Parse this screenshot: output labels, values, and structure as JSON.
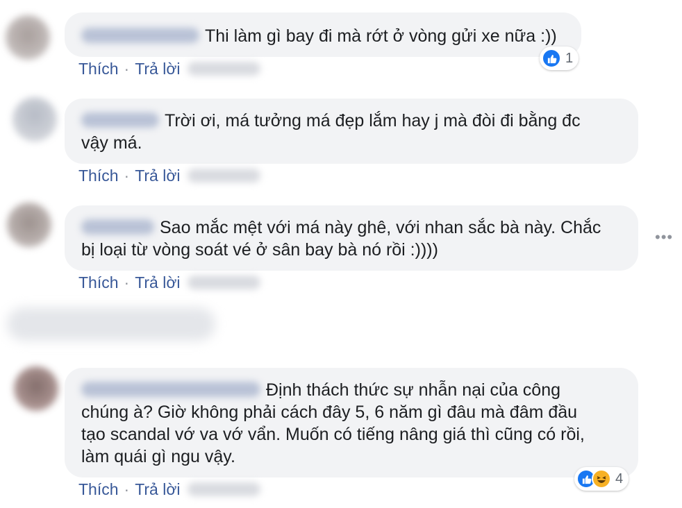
{
  "comments": [
    {
      "text": "Thi làm gì bay đi mà rớt ở vòng gửi xe nữa :))",
      "like_label": "Thích",
      "reply_label": "Trả lời",
      "reaction_count": "1"
    },
    {
      "text": "Trời ơi, má tưởng má đẹp lắm hay j mà đòi đi bằng đc\nvậy má.",
      "like_label": "Thích",
      "reply_label": "Trả lời"
    },
    {
      "text": "Sao mắc mệt với má này ghê, với nhan sắc bà này. Chắc\nbị loại từ vòng soát vé ở sân bay bà nó rồi :))))",
      "like_label": "Thích",
      "reply_label": "Trả lời"
    },
    {
      "text": "Định thách thức sự nhẫn nại của công\nchúng à? Giờ không phải cách đây 5, 6 năm gì đâu mà đâm đầu\ntạo scandal vớ va vớ vẩn. Muốn có tiếng nâng giá thì cũng có rồi,\nlàm quái gì ngu vậy.",
      "like_label": "Thích",
      "reply_label": "Trả lời",
      "reaction_count": "4"
    }
  ],
  "separator": "·",
  "icons": {
    "like": "like-icon",
    "haha": "haha-icon",
    "more": "more-options-icon"
  },
  "colors": {
    "bubble": "#f2f3f5",
    "link": "#385898",
    "like_blue": "#1877f2",
    "haha_yellow": "#f7b125"
  }
}
